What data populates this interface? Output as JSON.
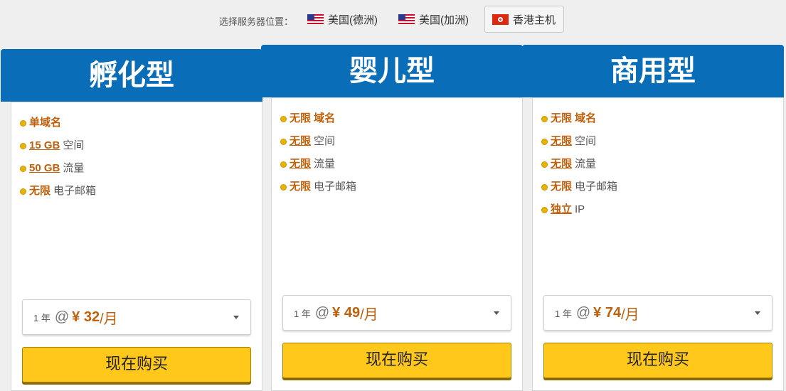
{
  "location": {
    "label": "选择服务器位置：",
    "options": [
      {
        "name": "美国(德洲)",
        "flag": "us-flag-icon"
      },
      {
        "name": "美国(加洲)",
        "flag": "us-flag-icon"
      },
      {
        "name": "香港主机",
        "flag": "hk-flag-icon",
        "selected": true
      }
    ]
  },
  "plans": [
    {
      "name": "孵化型",
      "features": [
        {
          "highlight": "单域名",
          "text": ""
        },
        {
          "highlight": "15 GB",
          "text": "空间"
        },
        {
          "highlight": "50 GB",
          "text": "流量"
        },
        {
          "highlight": "无限",
          "text": "电子邮箱"
        }
      ],
      "term": "1 年",
      "at": "@",
      "price": "¥ 32",
      "unit": "/月",
      "buy_label": "现在购买"
    },
    {
      "name": "婴儿型",
      "features": [
        {
          "highlight": "无限 域名",
          "text": ""
        },
        {
          "highlight": "无限",
          "text": "空间"
        },
        {
          "highlight": "无限",
          "text": "流量"
        },
        {
          "highlight": "无限",
          "text": "电子邮箱"
        }
      ],
      "term": "1 年",
      "at": "@",
      "price": "¥ 49",
      "unit": "/月",
      "buy_label": "现在购买"
    },
    {
      "name": "商用型",
      "features": [
        {
          "highlight": "无限 域名",
          "text": ""
        },
        {
          "highlight": "无限",
          "text": "空间"
        },
        {
          "highlight": "无限",
          "text": "流量"
        },
        {
          "highlight": "无限",
          "text": "电子邮箱"
        },
        {
          "highlight": "独立",
          "text": "IP"
        }
      ],
      "term": "1 年",
      "at": "@",
      "price": "¥ 74",
      "unit": "/月",
      "buy_label": "现在购买"
    }
  ],
  "colors": {
    "header_blue": "#0a6db8",
    "accent_orange": "#c0600a",
    "button_yellow": "#ffc81a"
  }
}
